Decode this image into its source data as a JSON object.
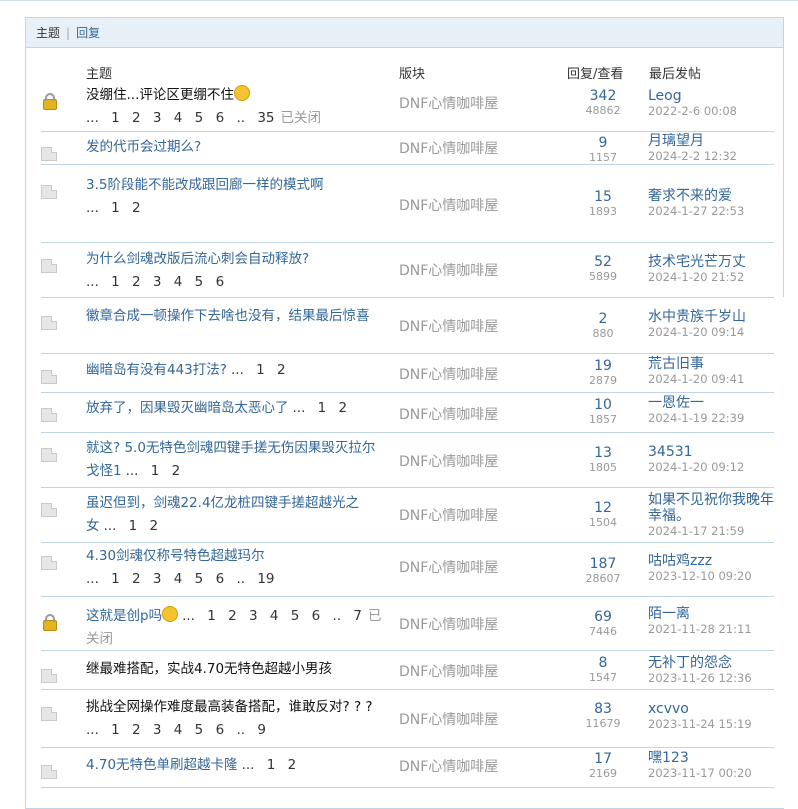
{
  "tabs": {
    "main": "主题",
    "reply": "回复"
  },
  "headers": {
    "subject": "主题",
    "forum": "版块",
    "stats": "回复/查看",
    "last": "最后发帖"
  },
  "rows": [
    {
      "icon": "lock",
      "title": "没绷住...评论区更绷不住",
      "emoji": true,
      "pager": "... 1 2 3 4 5 6 .. 35",
      "closed": "已关闭",
      "forum": "DNF心情咖啡屋",
      "replies": "342",
      "views": "48862",
      "last_user": "Leog",
      "last_time": "2022-2-6 00:08"
    },
    {
      "icon": "doc",
      "title": "发的代币会过期么?",
      "pager": "",
      "forum": "DNF心情咖啡屋",
      "replies": "9",
      "views": "1157",
      "last_user": "月璃望月",
      "last_time": "2024-2-2 12:32"
    },
    {
      "icon": "doc",
      "title": "3.5阶段能不能改成跟回廊一样的模式啊",
      "pager": "... 1 2",
      "forum": "DNF心情咖啡屋",
      "replies": "15",
      "views": "1893",
      "last_user": "奢求不来的爱",
      "last_time": "2024-1-27 22:53"
    },
    {
      "icon": "doc",
      "title": "为什么剑魂改版后流心刺会自动释放?",
      "pager": "... 1 2 3 4 5 6",
      "forum": "DNF心情咖啡屋",
      "replies": "52",
      "views": "5899",
      "last_user": "技术宅光芒万丈",
      "last_time": "2024-1-20 21:52"
    },
    {
      "icon": "doc",
      "title": "徽章合成一顿操作下去啥也没有，结果最后惊喜",
      "pager": "",
      "forum": "DNF心情咖啡屋",
      "replies": "2",
      "views": "880",
      "last_user": "水中贵族千岁山",
      "last_time": "2024-1-20 09:14"
    },
    {
      "icon": "doc",
      "title": "幽暗岛有没有443打法?",
      "pager": "... 1 2",
      "forum": "DNF心情咖啡屋",
      "replies": "19",
      "views": "2879",
      "last_user": "荒古旧事",
      "last_time": "2024-1-20 09:41"
    },
    {
      "icon": "doc",
      "title": "放弃了，因果毁灭幽暗岛太恶心了",
      "pager": "... 1 2",
      "forum": "DNF心情咖啡屋",
      "replies": "10",
      "views": "1857",
      "last_user": "一恩佐一",
      "last_time": "2024-1-19 22:39"
    },
    {
      "icon": "doc",
      "title": "就这? 5.0无特色剑魂四键手搓无伤因果毁灭拉尔戈怪1",
      "pager": "... 1 2",
      "forum": "DNF心情咖啡屋",
      "replies": "13",
      "views": "1805",
      "last_user": "34531",
      "last_time": "2024-1-20 09:12"
    },
    {
      "icon": "doc",
      "title": "虽迟但到，剑魂22.4亿龙桩四键手搓超越光之女",
      "pager": "... 1 2",
      "forum": "DNF心情咖啡屋",
      "replies": "12",
      "views": "1504",
      "last_user": "如果不见祝你我晚年幸福。",
      "last_time": "2024-1-17 21:59"
    },
    {
      "icon": "doc",
      "title": "4.30剑魂仅称号特色超越玛尔",
      "pager": "... 1 2 3 4 5 6 .. 19",
      "forum": "DNF心情咖啡屋",
      "replies": "187",
      "views": "28607",
      "last_user": "咕咕鸡zzz",
      "last_time": "2023-12-10 09:20"
    },
    {
      "icon": "lock",
      "title": "这就是创p吗",
      "emoji": true,
      "pager": "... 1 2 3 4 5 6 .. 7",
      "closed": "已关闭",
      "forum": "DNF心情咖啡屋",
      "replies": "69",
      "views": "7446",
      "last_user": "陌一离",
      "last_time": "2021-11-28 21:11"
    },
    {
      "icon": "doc",
      "title": "继最难搭配，实战4.70无特色超越小男孩",
      "dark": true,
      "pager": "",
      "forum": "DNF心情咖啡屋",
      "replies": "8",
      "views": "1547",
      "last_user": "无补丁的怨念",
      "last_time": "2023-11-26 12:36"
    },
    {
      "icon": "doc",
      "title": "挑战全网操作难度最高装备搭配，谁敢反对? ? ?",
      "dark": true,
      "pager": "... 1 2 3 4 5 6 .. 9",
      "forum": "DNF心情咖啡屋",
      "replies": "83",
      "views": "11679",
      "last_user": "xcvvo",
      "last_time": "2023-11-24 15:19"
    },
    {
      "icon": "doc",
      "title": "4.70无特色单刷超越卡隆",
      "pager": "... 1 2",
      "forum": "DNF心情咖啡屋",
      "replies": "17",
      "views": "2169",
      "last_user": "嘿123",
      "last_time": "2023-11-17 00:20"
    }
  ]
}
